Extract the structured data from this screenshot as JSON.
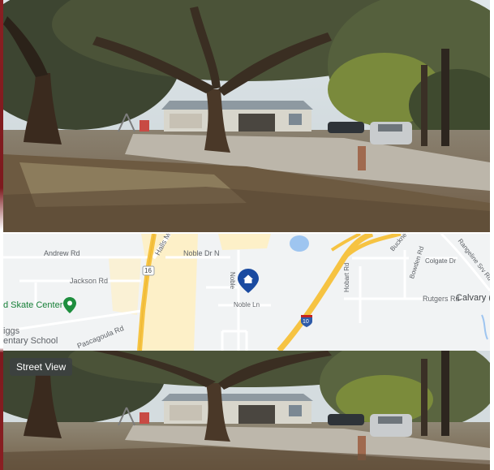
{
  "map": {
    "roads": {
      "andrew": "Andrew Rd",
      "halls_mill": "Halls Mill Rd",
      "noble_dr_n": "Noble Dr N",
      "noble_vertical": "Noble",
      "jackson": "Jackson Rd",
      "noble_ln": "Noble Ln",
      "hobart": "Hobart Rd",
      "bowden": "Bowden Rd",
      "colgate": "Colgate Dr",
      "buckner": "Buckne",
      "rangeline": "Rangeline Srv Rd",
      "rutgers": "Rutgers Rd",
      "pascagoula": "Pascagoula Rd"
    },
    "places": {
      "skate_center": "d Skate Center",
      "calvary": "Calvary (",
      "school_line1": "iggs",
      "school_line2": "entary School"
    },
    "shields": {
      "route16": "16",
      "interstate10": "10"
    },
    "colors": {
      "highway": "#f6c342",
      "land": "#f1f3f4",
      "zone": "#fdf0c8",
      "water": "#9ec5f0",
      "pin": "#1a4aa0",
      "place_green": "#1e8e3e"
    }
  },
  "street_view_label": "Street View",
  "icons": {
    "home_pin": "home-pin-icon",
    "skate_pin": "place-pin-icon"
  }
}
